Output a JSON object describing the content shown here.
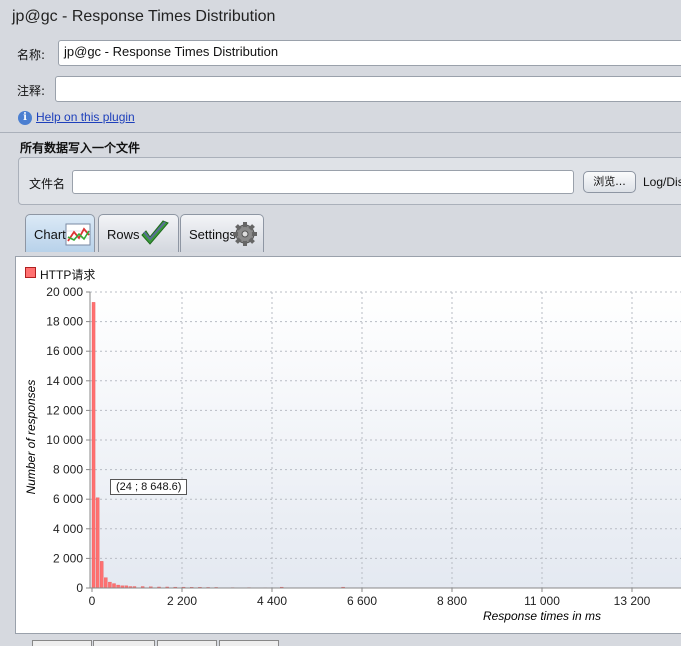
{
  "window": {
    "title": "jp@gc - Response Times Distribution"
  },
  "form": {
    "name_label": "名称:",
    "name_value": "jp@gc - Response Times Distribution",
    "comment_label": "注释:",
    "comment_value": "",
    "help_link": "Help on this plugin"
  },
  "file_section": {
    "header": "所有数据写入一个文件",
    "filename_label": "文件名",
    "filename_value": "",
    "browse_button": "浏览...",
    "log_label": "Log/Dis"
  },
  "tabs": [
    {
      "label": "Chart",
      "icon": "line-chart-icon",
      "active": true
    },
    {
      "label": "Rows",
      "icon": "checkmark-icon",
      "active": false
    },
    {
      "label": "Settings",
      "icon": "gear-icon",
      "active": false
    }
  ],
  "chart_data": {
    "type": "bar",
    "legend": [
      "HTTP请求"
    ],
    "legend_position": "top-left",
    "series": [
      {
        "name": "HTTP请求",
        "color": "#ff7070",
        "x": [
          0,
          100,
          200,
          300,
          400,
          500,
          600,
          700,
          800,
          900,
          1000,
          1200,
          1400,
          1600,
          1800,
          2000,
          2200,
          2400,
          2600,
          2800,
          3000,
          3400,
          3800,
          4200,
          4600,
          5000,
          6100
        ],
        "y": [
          19300,
          6100,
          1800,
          700,
          400,
          300,
          200,
          150,
          150,
          100,
          100,
          100,
          80,
          70,
          70,
          60,
          60,
          50,
          50,
          40,
          40,
          30,
          30,
          25,
          60,
          20,
          60
        ]
      }
    ],
    "bar_width_ms": 100,
    "xlabel": "Response times in ms",
    "ylabel": "Number of responses",
    "ylim": [
      0,
      20000
    ],
    "yticks": [
      0,
      2000,
      4000,
      6000,
      8000,
      10000,
      12000,
      14000,
      16000,
      18000,
      20000
    ],
    "ytick_labels": [
      "0",
      "2 000",
      "4 000",
      "6 000",
      "8 000",
      "10 000",
      "12 000",
      "14 000",
      "16 000",
      "18 000",
      "20 000"
    ],
    "xlim": [
      0,
      14500
    ],
    "xticks": [
      0,
      2200,
      4400,
      6600,
      8800,
      11000,
      13200
    ],
    "xtick_labels": [
      "0",
      "2 200",
      "4 400",
      "6 600",
      "8 800",
      "11 000",
      "13 200"
    ],
    "grid": true,
    "tooltip": "(24 ; 8 648.6)"
  }
}
